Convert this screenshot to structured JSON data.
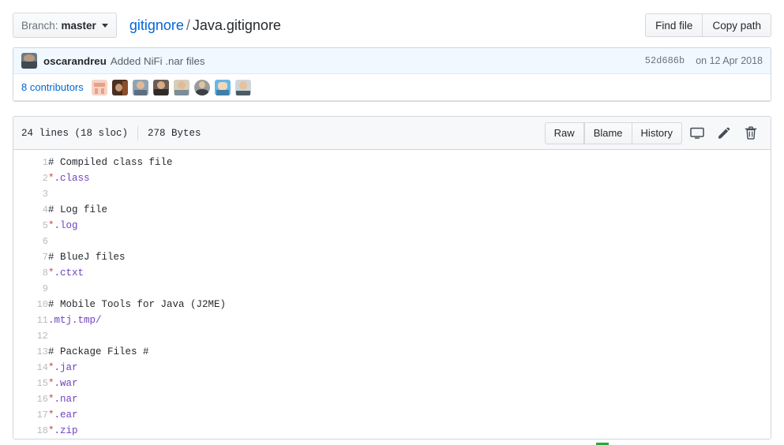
{
  "topbar": {
    "branch_label": "Branch:",
    "branch_name": "master",
    "breadcrumb": {
      "repo": "gitignore",
      "separator": "/",
      "file": "Java.gitignore"
    },
    "find_file_label": "Find file",
    "copy_path_label": "Copy path"
  },
  "commit": {
    "author": "oscarandreu",
    "message": "Added NiFi .nar files",
    "sha": "52d686b",
    "date": "on 12 Apr 2018"
  },
  "contributors": {
    "label": "8 contributors",
    "count": 8
  },
  "file_header": {
    "lines": "24 lines (18 sloc)",
    "size": "278 Bytes",
    "raw_label": "Raw",
    "blame_label": "Blame",
    "history_label": "History",
    "icons": [
      "desktop-icon",
      "pencil-icon",
      "trash-icon"
    ]
  },
  "code": {
    "lines": [
      {
        "n": "1",
        "tokens": [
          {
            "t": "comment",
            "v": "# Compiled class file"
          }
        ]
      },
      {
        "n": "2",
        "tokens": [
          {
            "t": "star",
            "v": "*"
          },
          {
            "t": "path",
            "v": ".class"
          }
        ]
      },
      {
        "n": "3",
        "tokens": []
      },
      {
        "n": "4",
        "tokens": [
          {
            "t": "comment",
            "v": "# Log file"
          }
        ]
      },
      {
        "n": "5",
        "tokens": [
          {
            "t": "star",
            "v": "*"
          },
          {
            "t": "path",
            "v": ".log"
          }
        ]
      },
      {
        "n": "6",
        "tokens": []
      },
      {
        "n": "7",
        "tokens": [
          {
            "t": "comment",
            "v": "# BlueJ files"
          }
        ]
      },
      {
        "n": "8",
        "tokens": [
          {
            "t": "star",
            "v": "*"
          },
          {
            "t": "path",
            "v": ".ctxt"
          }
        ]
      },
      {
        "n": "9",
        "tokens": []
      },
      {
        "n": "10",
        "tokens": [
          {
            "t": "comment",
            "v": "# Mobile Tools for Java (J2ME)"
          }
        ]
      },
      {
        "n": "11",
        "tokens": [
          {
            "t": "path",
            "v": ".mtj.tmp/"
          }
        ]
      },
      {
        "n": "12",
        "tokens": []
      },
      {
        "n": "13",
        "tokens": [
          {
            "t": "comment",
            "v": "# Package Files #"
          }
        ]
      },
      {
        "n": "14",
        "tokens": [
          {
            "t": "star",
            "v": "*"
          },
          {
            "t": "path",
            "v": ".jar"
          }
        ]
      },
      {
        "n": "15",
        "tokens": [
          {
            "t": "star",
            "v": "*"
          },
          {
            "t": "path",
            "v": ".war"
          }
        ]
      },
      {
        "n": "16",
        "tokens": [
          {
            "t": "star",
            "v": "*"
          },
          {
            "t": "path",
            "v": ".nar"
          }
        ]
      },
      {
        "n": "17",
        "tokens": [
          {
            "t": "star",
            "v": "*"
          },
          {
            "t": "path",
            "v": ".ear"
          }
        ]
      },
      {
        "n": "18",
        "tokens": [
          {
            "t": "star",
            "v": "*"
          },
          {
            "t": "path",
            "v": ".zip"
          }
        ]
      }
    ]
  },
  "colors": {
    "link": "#0366d6",
    "commit_row_bg": "#f1f8ff",
    "header_bg": "#f6f8fa",
    "border": "#d1d5da",
    "token_star": "#d73a49",
    "token_path": "#6f42c1",
    "accent_green": "#28a745"
  }
}
